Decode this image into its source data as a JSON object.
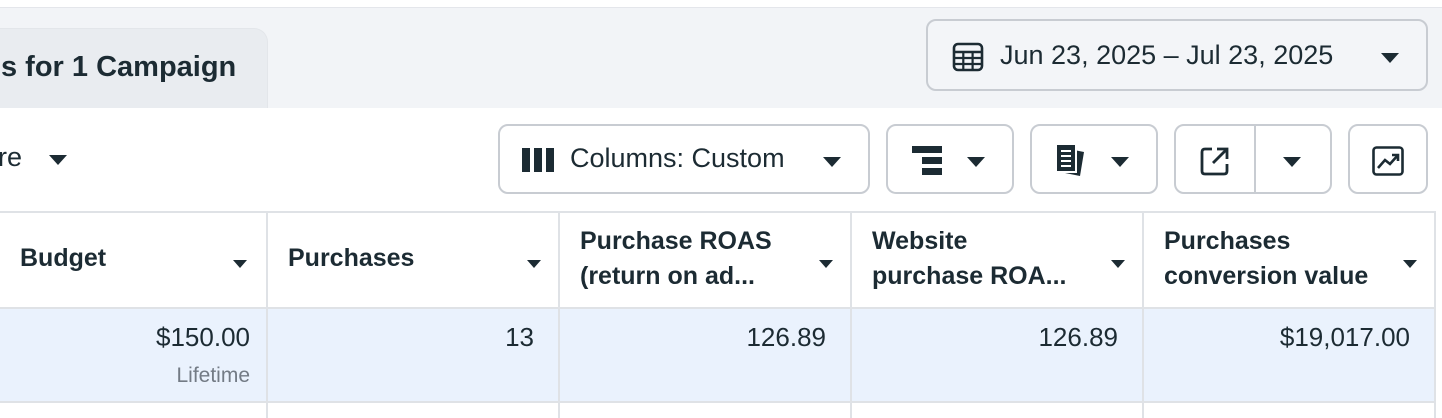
{
  "header": {
    "campaign_tab_label": "s for 1 Campaign",
    "date_range": "Jun 23, 2025 – Jul 23, 2025"
  },
  "toolbar": {
    "more_label": "re",
    "columns_label": "Columns: Custom"
  },
  "table": {
    "columns": [
      {
        "label": "Budget"
      },
      {
        "label": "Purchases"
      },
      {
        "label_line1": "Purchase ROAS",
        "label_line2": "(return on ad..."
      },
      {
        "label_line1": "Website",
        "label_line2": "purchase ROA..."
      },
      {
        "label_line1": "Purchases",
        "label_line2": "conversion value"
      }
    ],
    "row": {
      "budget": "$150.00",
      "budget_type": "Lifetime",
      "purchases": "13",
      "purchase_roas": "126.89",
      "website_purchase_roas": "126.89",
      "conversion_value": "$19,017.00"
    }
  },
  "icons": {
    "calendar": "calendar-icon",
    "columns": "columns-icon",
    "breakdown": "breakdown-icon",
    "reports": "reports-icon",
    "export": "export-icon",
    "chart": "chart-icon",
    "caret": "caret-down-icon"
  },
  "colors": {
    "selected_row": "#eaf2fd",
    "text": "#1c2b33",
    "muted_text": "#737b85",
    "border": "#c8ccd2"
  }
}
